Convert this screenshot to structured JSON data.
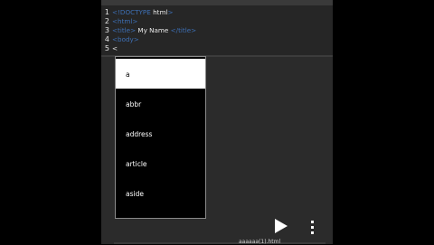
{
  "editor": {
    "line_numbers": [
      "1",
      "2",
      "3",
      "4",
      "5"
    ],
    "lines": {
      "l1": {
        "tag_open": "<!DOCTYPE",
        "text": " html",
        "tag_close": ">"
      },
      "l2": {
        "tag": "<html>"
      },
      "l3": {
        "tag_open": "<title>",
        "text": " My Name ",
        "tag_close": "</title>"
      },
      "l4": {
        "tag": "<body>"
      },
      "l5": {
        "text": "<"
      }
    }
  },
  "autocomplete": {
    "items": [
      "a",
      "abbr",
      "address",
      "article",
      "aside"
    ],
    "selected_index": 0
  },
  "bottom_bar": {
    "file_name": "aaaaaa(1).html"
  },
  "colors": {
    "background": "#000000",
    "editor_bg": "#2b2b2b",
    "tag_color": "#3d6fb4",
    "text_color": "#eaeaea",
    "popup_bg": "#000000",
    "selected_bg": "#ffffff"
  },
  "icons": {
    "run": "play-icon",
    "menu": "kebab-menu-icon"
  }
}
